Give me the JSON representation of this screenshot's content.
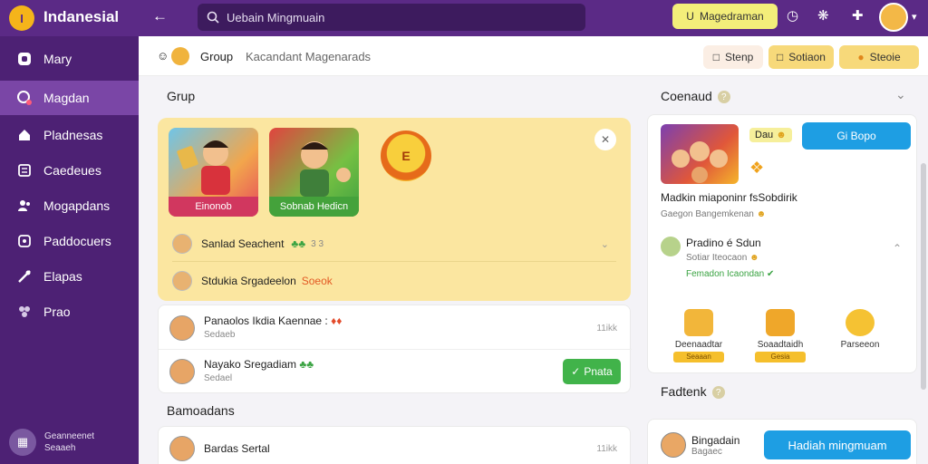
{
  "app": {
    "title": "Indanesial",
    "logo_letter": "I"
  },
  "search": {
    "placeholder": "Uebain Mingmuain"
  },
  "topbar": {
    "yellow_button": "Magedraman",
    "yellow_icon": "U"
  },
  "sidebar": {
    "items": [
      {
        "label": "Mary",
        "icon": "home-icon"
      },
      {
        "label": "Magdan",
        "icon": "chat-icon"
      },
      {
        "label": "Pladnesas",
        "icon": "house-icon"
      },
      {
        "label": "Caedeues",
        "icon": "grid-icon"
      },
      {
        "label": "Mogapdans",
        "icon": "people-icon"
      },
      {
        "label": "Paddocuers",
        "icon": "puzzle-icon"
      },
      {
        "label": "Elapas",
        "icon": "tools-icon"
      },
      {
        "label": "Prao",
        "icon": "group-icon"
      }
    ],
    "footer": {
      "line1": "Geanneenet",
      "line2": "Seaaeh"
    }
  },
  "subheader": {
    "group_label": "Group",
    "subtitle": "Kacandant Magenarads",
    "pill_1": "Stenp",
    "pill_2": "Sotiaon",
    "pill_3": "Steoie"
  },
  "main": {
    "group_section_title": "Grup",
    "tiles": [
      {
        "label": "Einonob"
      },
      {
        "label": "Sobnab Hedicn"
      }
    ],
    "coin_label": "E",
    "card_rows": [
      {
        "text": "Sanlad Seachent",
        "extra": "3 3"
      },
      {
        "text": "Stdukia Srgadeelon",
        "tag": "Soeok"
      }
    ],
    "list_rows": [
      {
        "name": "Panaolos Ikdia Kaennae :",
        "sub": "Sedaeb",
        "time": "11ikk"
      },
      {
        "name": "Nayako Sregadiam",
        "sub": "Sedael",
        "button": "Pnata"
      }
    ],
    "bottom_section_title": "Bamoadans",
    "bottom_rows": [
      {
        "name": "Bardas Sertal",
        "time": "11ikk"
      }
    ]
  },
  "right": {
    "section_title": "Coenaud",
    "card": {
      "badge": "Dau",
      "button": "Gi Bopo",
      "headline": "Madkin miaponinr fsSobdirik",
      "line2": "Gaegon Bangemkenan",
      "person_name": "Pradino é Sdun",
      "person_sub": "Sotiar Iteocaon",
      "person_sub2": "Femadon Icaondan",
      "rewards": [
        {
          "name": "Deenaadtar",
          "tag": "Seaaan"
        },
        {
          "name": "Soaadtaidh",
          "tag": "Gesia"
        },
        {
          "name": "Parseeon",
          "tag": ""
        }
      ]
    },
    "section2_title": "Fadtenk",
    "card2": {
      "name": "Bingadain",
      "sub": "Bagaec",
      "button": "Hadiah mingmuam"
    }
  }
}
